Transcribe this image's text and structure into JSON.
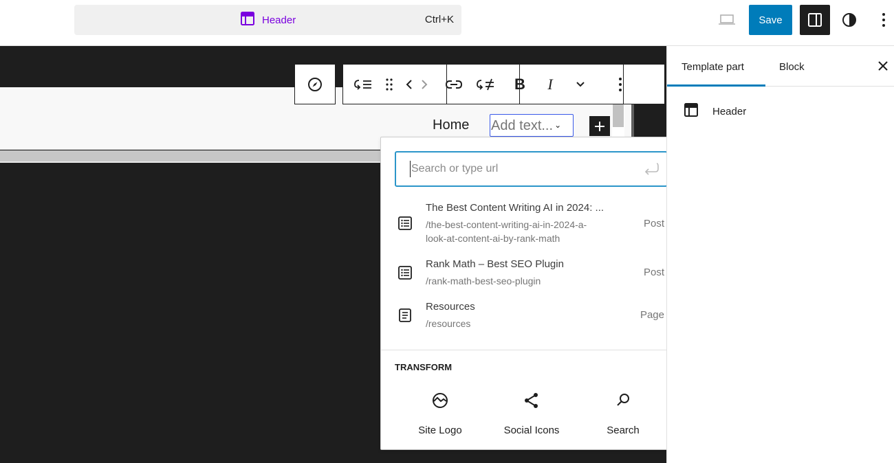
{
  "topbar": {
    "command_title": "Header",
    "shortcut": "Ctrl+K",
    "save_label": "Save",
    "icons": [
      "desktop-preview-icon",
      "sidebar-settings-icon",
      "styles-contrast-icon",
      "more-options-icon"
    ]
  },
  "canvas": {
    "nav_items": [
      "Home"
    ],
    "nav_input_placeholder": "Add text..."
  },
  "toolbar": {
    "icons": [
      "compass-icon",
      "submenu-icon",
      "drag-handle-icon",
      "chevron-left-icon",
      "chevron-right-icon",
      "link-icon",
      "unlink-icon",
      "bold-icon",
      "italic-icon",
      "chevron-down-icon",
      "more-vertical-icon"
    ]
  },
  "popover": {
    "search_placeholder": "Search or type url",
    "results": [
      {
        "title": "The Best Content Writing AI in 2024: ...",
        "url_line1": "/the-best-content-writing-ai-in-2024-a-",
        "url_line2": "look-at-content-ai-by-rank-math",
        "type": "Post"
      },
      {
        "title": "Rank Math – Best SEO Plugin",
        "url_line1": "/rank-math-best-seo-plugin",
        "type": "Post"
      },
      {
        "title": "Resources",
        "url_line1": "/resources",
        "type": "Page"
      }
    ],
    "transform_label": "TRANSFORM",
    "transform_items": [
      "Site Logo",
      "Social Icons",
      "Search"
    ]
  },
  "sidebar": {
    "tabs": [
      "Template part",
      "Block"
    ],
    "active_tab": "Template part",
    "item_label": "Header"
  },
  "colors": {
    "accent": "#007cba",
    "purple": "#7a00df",
    "canvas_bg": "#1e1e1e",
    "focus": "#3858e9"
  }
}
